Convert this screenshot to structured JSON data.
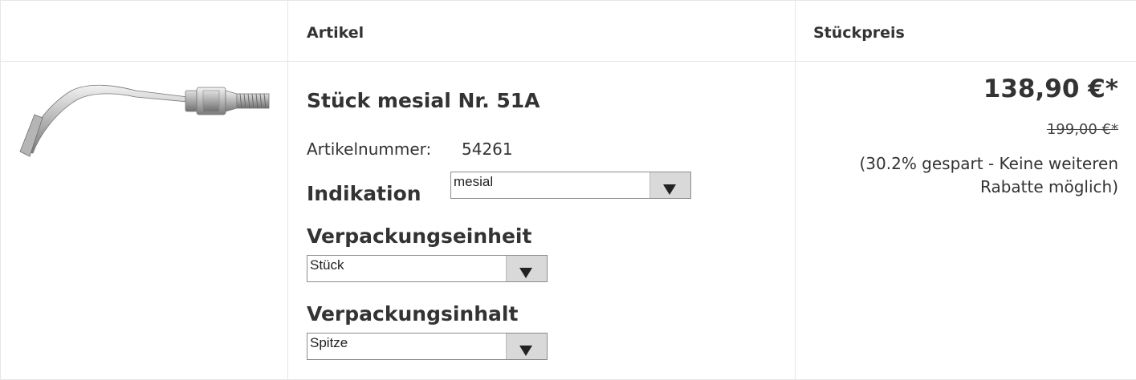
{
  "table": {
    "headers": {
      "image": "",
      "article": "Artikel",
      "unit_price": "Stückpreis"
    }
  },
  "product": {
    "image_icon": "dental-scaler-tip-icon",
    "name": "Stück mesial Nr. 51A",
    "article_number_label": "Artikelnummer:",
    "article_number": "54261",
    "options": [
      {
        "label": "Indikation",
        "selected": "mesial"
      },
      {
        "label": "Verpackungseinheit",
        "selected": "Stück"
      },
      {
        "label": "Verpackungsinhalt",
        "selected": "Spitze"
      }
    ]
  },
  "pricing": {
    "price": "138,90 €*",
    "old_price": "199,00 €*",
    "savings_note": "(30.2% gespart - Keine weiteren Rabatte möglich)"
  },
  "colors": {
    "border": "#e6e6e6",
    "text": "#333333",
    "select_button": "#d9d9d9"
  }
}
